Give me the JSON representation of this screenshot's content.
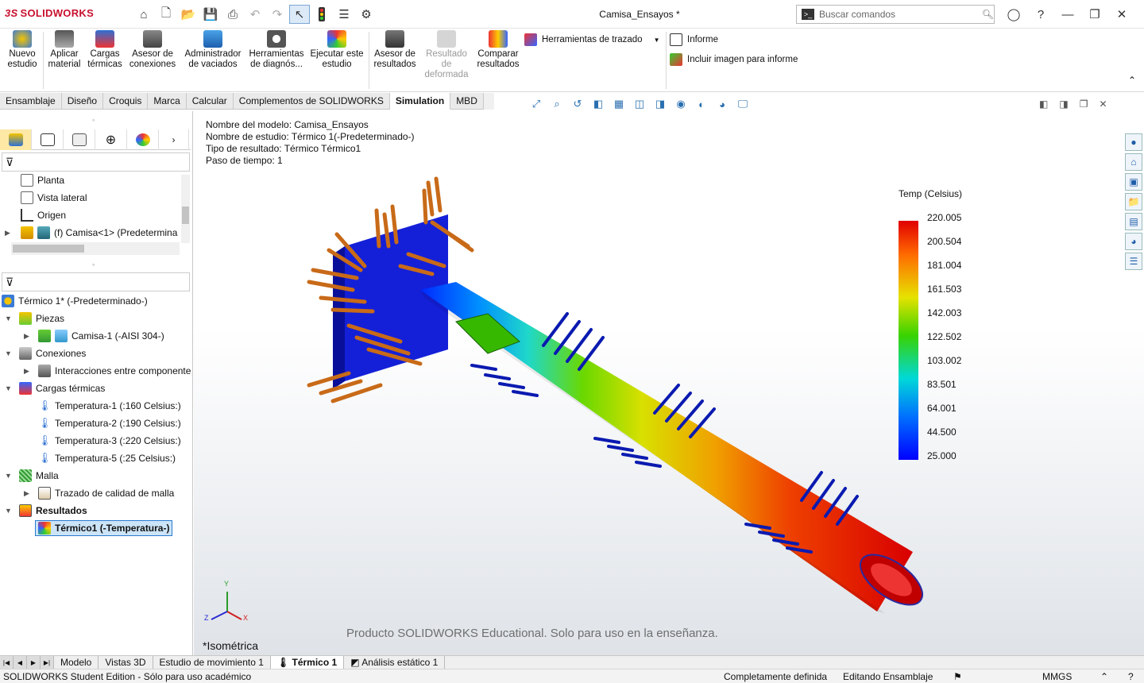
{
  "app": {
    "brand": "SOLIDWORKS",
    "doc_title": "Camisa_Ensayos *"
  },
  "search": {
    "placeholder": "Buscar comandos"
  },
  "ribbon": {
    "nuevo_estudio": "Nuevo estudio",
    "aplicar_material": "Aplicar material",
    "cargas_termicas": "Cargas térmicas",
    "asesor_conexiones": "Asesor de conexiones",
    "administrador_vaciados": "Administrador de vaciados",
    "herramientas_diagnostico": "Herramientas de diagnós...",
    "ejecutar_estudio": "Ejecutar este estudio",
    "asesor_resultados": "Asesor de resultados",
    "resultado_deformada": "Resultado de deformada",
    "comparar_resultados": "Comparar resultados",
    "herramientas_trazado": "Herramientas de trazado",
    "informe": "Informe",
    "incluir_imagen": "Incluir imagen para informe"
  },
  "command_tabs": [
    "Ensamblaje",
    "Diseño",
    "Croquis",
    "Marca",
    "Calcular",
    "Complementos de SOLIDWORKS",
    "Simulation",
    "MBD"
  ],
  "feature_tree": {
    "items": [
      "Planta",
      "Vista lateral",
      "Origen",
      "(f) Camisa<1> (Predetermina"
    ]
  },
  "study_tree": {
    "root": "Térmico 1* (-Predeterminado-)",
    "piezas": "Piezas",
    "camisa": "Camisa-1 (-AISI 304-)",
    "conexiones": "Conexiones",
    "interacciones": "Interacciones entre componente",
    "cargas": "Cargas térmicas",
    "temps": [
      "Temperatura-1 (:160 Celsius:)",
      "Temperatura-2 (:190 Celsius:)",
      "Temperatura-3 (:220 Celsius:)",
      "Temperatura-5 (:25 Celsius:)"
    ],
    "malla": "Malla",
    "trazado_malla": "Trazado de calidad de malla",
    "resultados": "Resultados",
    "termico1": "Térmico1 (-Temperatura-)"
  },
  "viewport": {
    "info": [
      "Nombre del modelo: Camisa_Ensayos",
      "Nombre de estudio: Térmico 1(-Predeterminado-)",
      "Tipo de resultado: Térmico Térmico1",
      "Paso de tiempo: 1"
    ],
    "legend_title": "Temp (Celsius)",
    "legend_values": [
      "220.005",
      "200.504",
      "181.004",
      "161.503",
      "142.003",
      "122.502",
      "103.002",
      "83.501",
      "64.001",
      "44.500",
      "25.000"
    ],
    "watermark": "Producto SOLIDWORKS Educational. Solo para uso en la enseñanza.",
    "view_name": "*Isométrica",
    "axis_x": "X",
    "axis_y": "Y",
    "axis_z": "Z"
  },
  "bottom_tabs": [
    "Modelo",
    "Vistas 3D",
    "Estudio de movimiento 1",
    "Térmico 1",
    "Análisis estático 1"
  ],
  "status": {
    "left": "SOLIDWORKS Student Edition - Sólo para uso académico",
    "defined": "Completamente definida",
    "editing": "Editando Ensamblaje",
    "units": "MMGS"
  },
  "colors": {
    "brand": "#c8102e",
    "selection": "#cce4f7",
    "active_tab": "#fde8a5"
  }
}
